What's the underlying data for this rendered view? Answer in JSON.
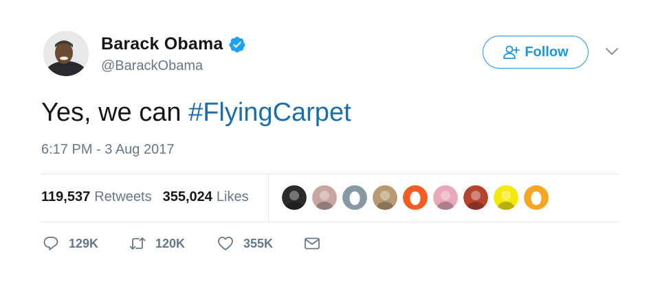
{
  "author": {
    "name": "Barack Obama",
    "handle": "@BarackObama",
    "verified": true
  },
  "follow_button": {
    "label": "Follow",
    "icon": "add-user-icon"
  },
  "menu": {
    "icon": "chevron-down-icon"
  },
  "tweet": {
    "text_prefix": "Yes, we can ",
    "hashtag": "#FlyingCarpet",
    "timestamp": "6:17 PM - 3 Aug 2017"
  },
  "stats": {
    "retweets_count": "119,537",
    "retweets_label": "Retweets",
    "likes_count": "355,024",
    "likes_label": "Likes"
  },
  "likers": [
    {
      "kind": "photo",
      "color": "#2b2b2b"
    },
    {
      "kind": "photo",
      "color": "#c9a6a0"
    },
    {
      "kind": "egg",
      "color": "#8899a6"
    },
    {
      "kind": "photo",
      "color": "#b89a72"
    },
    {
      "kind": "egg",
      "color": "#f45d22"
    },
    {
      "kind": "photo",
      "color": "#e9a7b8"
    },
    {
      "kind": "photo",
      "color": "#b5432e"
    },
    {
      "kind": "photo",
      "color": "#f5e80b"
    },
    {
      "kind": "egg",
      "color": "#f5a623"
    }
  ],
  "actions": {
    "reply": {
      "icon": "reply-icon",
      "count": "129K"
    },
    "retweet": {
      "icon": "retweet-icon",
      "count": "120K"
    },
    "like": {
      "icon": "heart-icon",
      "count": "355K"
    },
    "message": {
      "icon": "envelope-icon"
    }
  },
  "colors": {
    "accent": "#1b95e0",
    "hashtag": "#1b6eac",
    "secondary_text": "#657786",
    "divider": "#e1e8ed"
  }
}
